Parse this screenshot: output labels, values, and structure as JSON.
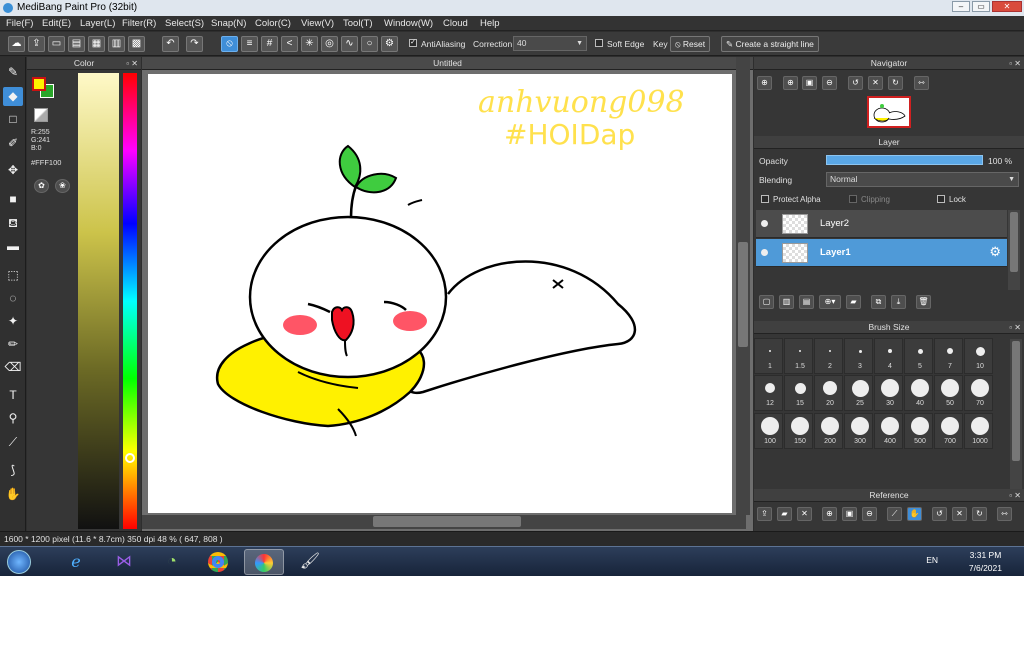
{
  "window": {
    "title": "MediBang Paint Pro (32bit)",
    "minimize": "–",
    "maximize": "▭",
    "close": "✕"
  },
  "menu": [
    "File(F)",
    "Edit(E)",
    "Layer(L)",
    "Filter(R)",
    "Select(S)",
    "Snap(N)",
    "Color(C)",
    "View(V)",
    "Tool(T)",
    "Window(W)",
    "Cloud",
    "Help"
  ],
  "toolbar": {
    "antialiasing_label": "AntiAliasing",
    "antialiasing_checked": true,
    "correction_label": "Correction",
    "correction_value": "40",
    "soft_edge_label": "Soft Edge",
    "key_label": "Key",
    "reset_label": "Reset",
    "straight_line_label": "Create a straight line"
  },
  "color_panel": {
    "title": "Color",
    "r": "R:255",
    "g": "G:241",
    "b": "B:0",
    "hex": "#FFF100",
    "fg_color": "#FFF100",
    "bg_color": "#2aa52a"
  },
  "canvas": {
    "tab_title": "Untitled",
    "handwriting_line1": "anhvuong098",
    "handwriting_line2": "#HOIDap"
  },
  "navigator": {
    "title": "Navigator"
  },
  "layer_panel": {
    "title": "Layer",
    "opacity_label": "Opacity",
    "opacity_value": "100 %",
    "opacity": 1.0,
    "blending_label": "Blending",
    "blending_value": "Normal",
    "protect_alpha_label": "Protect Alpha",
    "clipping_label": "Clipping",
    "lock_label": "Lock",
    "layers": [
      {
        "name": "Layer2",
        "selected": false
      },
      {
        "name": "Layer1",
        "selected": true
      }
    ]
  },
  "brush_size": {
    "title": "Brush Size",
    "sizes": [
      "1",
      "1.5",
      "2",
      "3",
      "4",
      "5",
      "7",
      "10",
      "12",
      "15",
      "20",
      "25",
      "30",
      "40",
      "50",
      "70",
      "100",
      "150",
      "200",
      "300",
      "400",
      "500",
      "700",
      "1000"
    ]
  },
  "reference": {
    "title": "Reference"
  },
  "status": {
    "text": "1600 * 1200 pixel   (11.6 * 8.7cm)   350 dpi   48 %   ( 647, 808 )"
  },
  "taskbar": {
    "apps": [
      "start-orb",
      "internet-explorer",
      "visual-studio",
      "utorrent",
      "chrome",
      "medibang",
      "paint-brush"
    ],
    "language": "EN",
    "time": "3:31 PM",
    "date": "7/6/2021"
  },
  "colors": {
    "accent": "#3f8ed8",
    "panel": "#363636",
    "yellow": "#FFF100",
    "sprout": "#3fcc3f",
    "cheek": "#ff5566",
    "tongue": "#ee1122"
  }
}
